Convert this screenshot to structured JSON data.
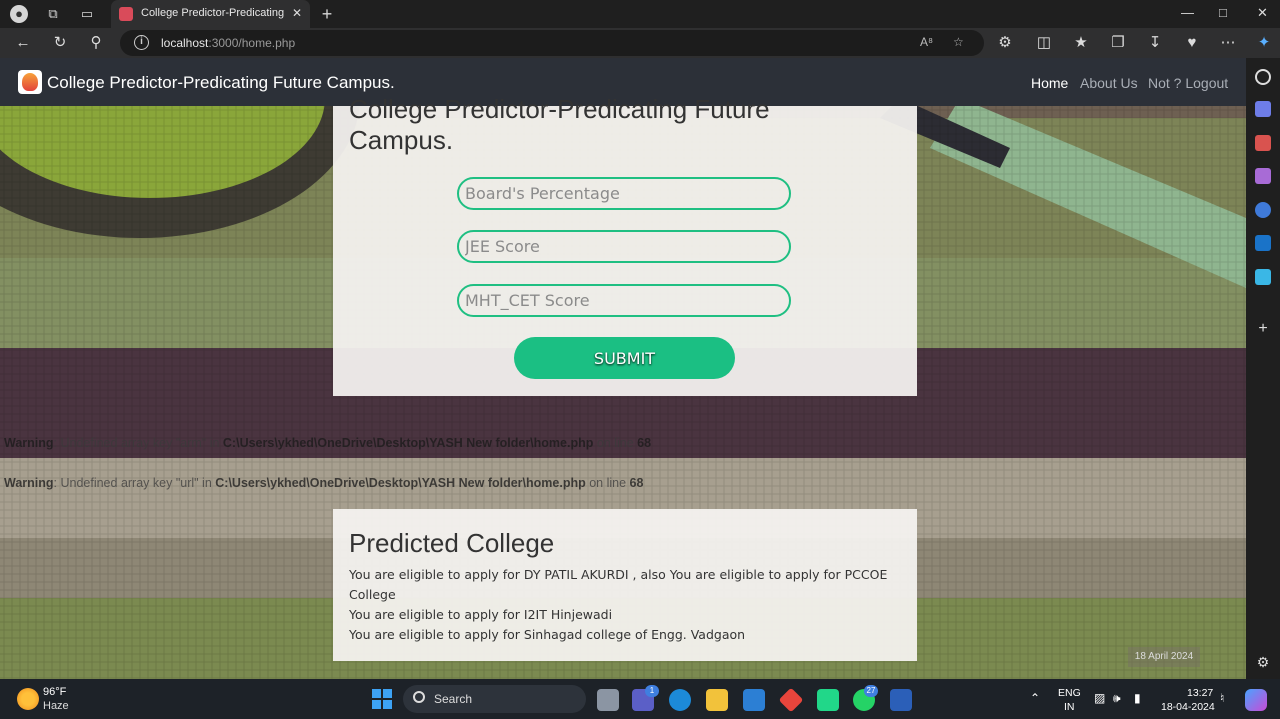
{
  "browser": {
    "tab_title": "College Predictor-Predicating Fut",
    "url_host": "localhost",
    "url_path": ":3000/home.php",
    "colors": {
      "chrome": "#2f2f30",
      "tabbar": "#1f1f1f"
    }
  },
  "navbar": {
    "brand": "College Predictor-Predicating Future Campus.",
    "links": [
      "Home",
      "About Us",
      "Not ? Logout"
    ],
    "active": "Home",
    "colors": {
      "bg": "#2c3038",
      "accent": "#1bbf83"
    }
  },
  "form": {
    "heading": "College Predictor-Predicating Future Campus.",
    "board_placeholder": "Board's Percentage",
    "jee_placeholder": "JEE Score",
    "mht_placeholder": "MHT_CET Score",
    "submit_label": "SUBMIT"
  },
  "warnings": [
    {
      "label": "Warning",
      "mid": ": Undefined array key \"arm\" in ",
      "file": "C:\\Users\\ykhed\\OneDrive\\Desktop\\YASH New folder\\home.php",
      "on_line": " on line ",
      "line": "68"
    },
    {
      "label": "Warning",
      "mid": ": Undefined array key \"url\" in ",
      "file": "C:\\Users\\ykhed\\OneDrive\\Desktop\\YASH New folder\\home.php",
      "on_line": " on line ",
      "line": "68"
    }
  ],
  "result": {
    "title": "Predicted College",
    "lines": [
      "You are eligible to apply for DY PATIL AKURDI , also You are eligible to apply for PCCOE College",
      "You are eligible to apply for I2IT Hinjewadi",
      "You are eligible to apply for Sinhagad college of Engg. Vadgaon"
    ]
  },
  "date_badge": "18 April 2024",
  "taskbar": {
    "temp": "96°F",
    "condition": "Haze",
    "search_label": "Search",
    "teams_badge": "1",
    "whatsapp_badge": "27",
    "lang_1": "ENG",
    "lang_2": "IN",
    "time": "13:27",
    "date": "18-04-2024"
  }
}
